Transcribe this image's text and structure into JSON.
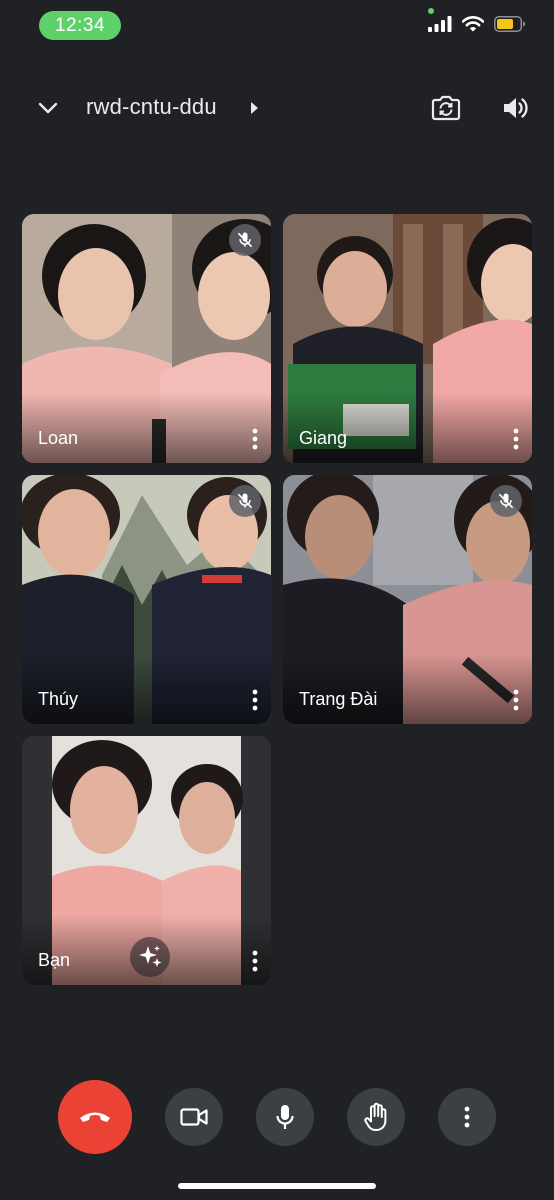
{
  "status_bar": {
    "time": "12:34",
    "icons": [
      "signal-icon",
      "wifi-icon",
      "battery-icon"
    ]
  },
  "header": {
    "meeting_code": "rwd-cntu-ddu",
    "icons": [
      "chevron-down-icon",
      "caret-right-icon",
      "switch-camera-icon",
      "speaker-icon"
    ]
  },
  "participants": [
    {
      "name": "Loan",
      "muted": true
    },
    {
      "name": "Giang",
      "muted": false
    },
    {
      "name": "Thúy",
      "muted": true
    },
    {
      "name": "Trang Đài",
      "muted": true
    },
    {
      "name": "Bạn",
      "muted": false,
      "self": true
    }
  ],
  "controls": [
    "end-call-icon",
    "camera-icon",
    "mic-icon",
    "raise-hand-icon",
    "more-options-icon"
  ],
  "colors": {
    "background": "#202124",
    "tile": "#3c4043",
    "end_call": "#ea4335",
    "time_pill": "#5fd16a",
    "battery": "#f5c518"
  }
}
